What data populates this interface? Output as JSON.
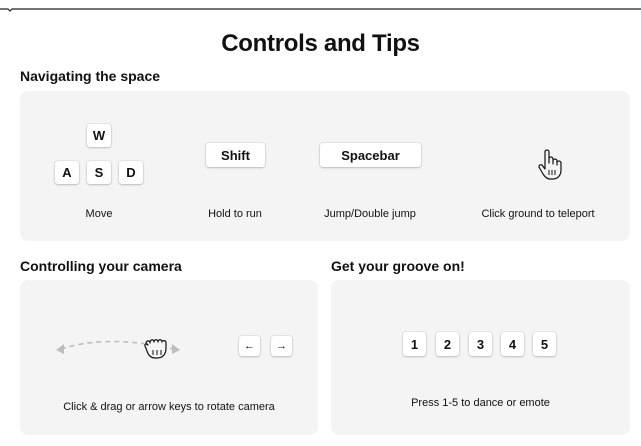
{
  "page": {
    "title": "Controls and Tips"
  },
  "navigating": {
    "heading": "Navigating the space",
    "keys": {
      "w": "W",
      "a": "A",
      "s": "S",
      "d": "D",
      "shift": "Shift",
      "spacebar": "Spacebar"
    },
    "captions": {
      "move": "Move",
      "run": "Hold to run",
      "jump": "Jump/Double jump",
      "teleport": "Click ground to teleport"
    },
    "icons": [
      "pointer-hand-icon"
    ]
  },
  "camera": {
    "heading": "Controlling your camera",
    "keys": {
      "left": "←",
      "right": "→"
    },
    "caption": "Click & drag or arrow keys to rotate camera",
    "icons": [
      "grab-hand-icon",
      "rotate-arrows-icon"
    ]
  },
  "groove": {
    "heading": "Get your groove on!",
    "keys": [
      "1",
      "2",
      "3",
      "4",
      "5"
    ],
    "caption": "Press 1-5 to dance or emote"
  },
  "colors": {
    "panel": "#f4f4f4",
    "key": "#ffffff",
    "text": "#111111",
    "dashed_arrow": "#bdbdbd"
  }
}
